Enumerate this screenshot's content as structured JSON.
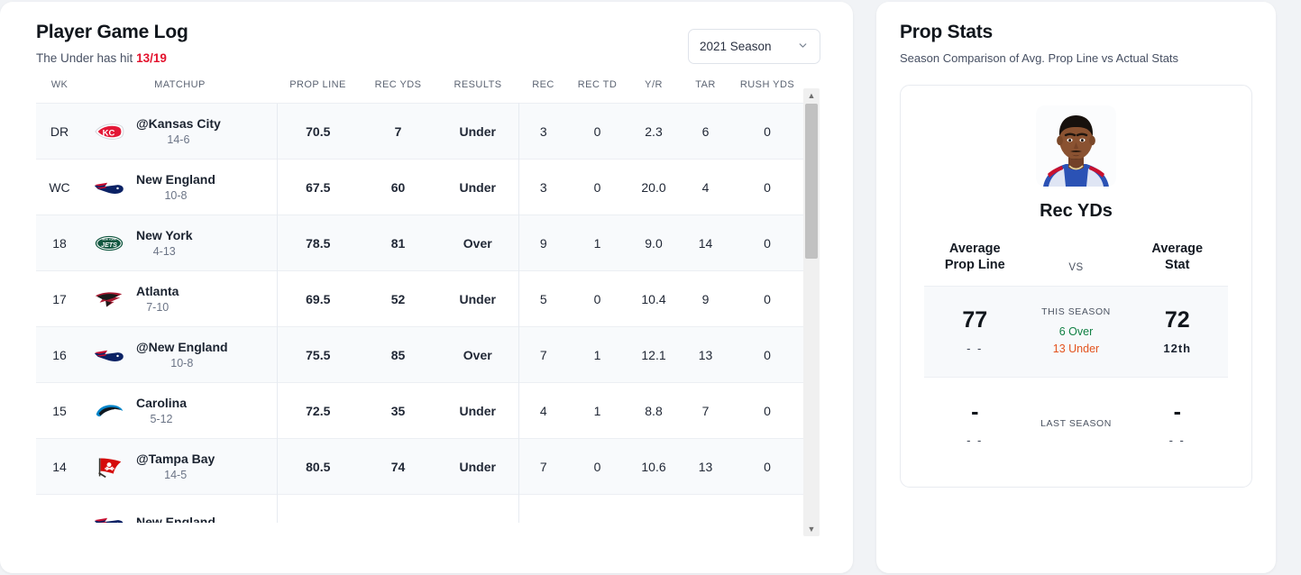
{
  "gamelog": {
    "title": "Player Game Log",
    "subtitle_prefix": "The Under has hit ",
    "subtitle_hits": "13/19",
    "season_value": "2021 Season",
    "chevron": "chevron-down",
    "columns": [
      "WK",
      "MATCHUP",
      "PROP LINE",
      "REC YDS",
      "RESULTS",
      "REC",
      "REC TD",
      "Y/R",
      "TAR",
      "RUSH YDS"
    ],
    "rows": [
      {
        "wk": "DR",
        "team": "@Kansas City",
        "record": "14-6",
        "logo": "kansas-city-chiefs",
        "prop_line": "70.5",
        "rec_yds": "7",
        "result": "Under",
        "rec": "3",
        "rec_td": "0",
        "yr": "2.3",
        "tar": "6",
        "rush_yds": "0"
      },
      {
        "wk": "WC",
        "team": "New England",
        "record": "10-8",
        "logo": "new-england-patriots",
        "prop_line": "67.5",
        "rec_yds": "60",
        "result": "Under",
        "rec": "3",
        "rec_td": "0",
        "yr": "20.0",
        "tar": "4",
        "rush_yds": "0"
      },
      {
        "wk": "18",
        "team": "New York",
        "record": "4-13",
        "logo": "new-york-jets",
        "prop_line": "78.5",
        "rec_yds": "81",
        "result": "Over",
        "rec": "9",
        "rec_td": "1",
        "yr": "9.0",
        "tar": "14",
        "rush_yds": "0"
      },
      {
        "wk": "17",
        "team": "Atlanta",
        "record": "7-10",
        "logo": "atlanta-falcons",
        "prop_line": "69.5",
        "rec_yds": "52",
        "result": "Under",
        "rec": "5",
        "rec_td": "0",
        "yr": "10.4",
        "tar": "9",
        "rush_yds": "0"
      },
      {
        "wk": "16",
        "team": "@New England",
        "record": "10-8",
        "logo": "new-england-patriots",
        "prop_line": "75.5",
        "rec_yds": "85",
        "result": "Over",
        "rec": "7",
        "rec_td": "1",
        "yr": "12.1",
        "tar": "13",
        "rush_yds": "0"
      },
      {
        "wk": "15",
        "team": "Carolina",
        "record": "5-12",
        "logo": "carolina-panthers",
        "prop_line": "72.5",
        "rec_yds": "35",
        "result": "Under",
        "rec": "4",
        "rec_td": "1",
        "yr": "8.8",
        "tar": "7",
        "rush_yds": "0"
      },
      {
        "wk": "14",
        "team": "@Tampa Bay",
        "record": "14-5",
        "logo": "tampa-bay-buccaneers",
        "prop_line": "80.5",
        "rec_yds": "74",
        "result": "Under",
        "rec": "7",
        "rec_td": "0",
        "yr": "10.6",
        "tar": "13",
        "rush_yds": "0"
      },
      {
        "wk": "",
        "team": "New England",
        "record": "",
        "logo": "new-england-patriots",
        "prop_line": "",
        "rec_yds": "",
        "result": "",
        "rec": "",
        "rec_td": "",
        "yr": "",
        "tar": "",
        "rush_yds": ""
      }
    ]
  },
  "propstats": {
    "title": "Prop Stats",
    "subtitle": "Season Comparison of Avg. Prop Line vs Actual Stats",
    "player_photo": "player-headshot",
    "stat_name": "Rec YDs",
    "header_left": "Average\nProp Line",
    "header_left_line1": "Average",
    "header_left_line2": "Prop Line",
    "header_mid": "VS",
    "header_right_line1": "Average",
    "header_right_line2": "Stat",
    "this_season": {
      "label": "THIS SEASON",
      "avg_prop_line": "77",
      "avg_prop_line_sub": "- -",
      "over": "6 Over",
      "under": "13 Under",
      "avg_stat": "72",
      "avg_stat_rank": "12th"
    },
    "last_season": {
      "label": "LAST SEASON",
      "avg_prop_line": "-",
      "avg_prop_line_sub": "- -",
      "avg_stat": "-",
      "avg_stat_sub": "- -"
    }
  },
  "colors": {
    "under": "#e3122d",
    "over": "#108043",
    "under_orange": "#e3541f",
    "page_bg": "#f1f3f6"
  }
}
